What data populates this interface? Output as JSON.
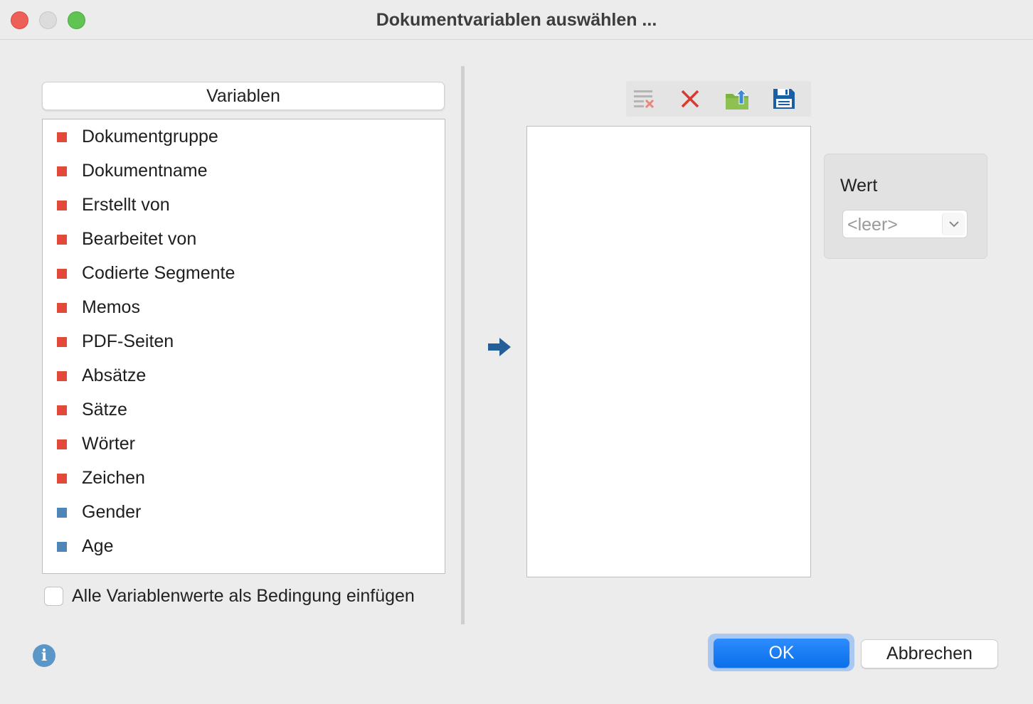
{
  "window": {
    "title": "Dokumentvariablen auswählen ..."
  },
  "variables": {
    "header": "Variablen",
    "items": [
      {
        "label": "Dokumentgruppe",
        "color": "#e2493a"
      },
      {
        "label": "Dokumentname",
        "color": "#e2493a"
      },
      {
        "label": "Erstellt von",
        "color": "#e2493a"
      },
      {
        "label": "Bearbeitet von",
        "color": "#e2493a"
      },
      {
        "label": "Codierte Segmente",
        "color": "#e2493a"
      },
      {
        "label": "Memos",
        "color": "#e2493a"
      },
      {
        "label": "PDF-Seiten",
        "color": "#e2493a"
      },
      {
        "label": "Absätze",
        "color": "#e2493a"
      },
      {
        "label": "Sätze",
        "color": "#e2493a"
      },
      {
        "label": "Wörter",
        "color": "#e2493a"
      },
      {
        "label": "Zeichen",
        "color": "#e2493a"
      },
      {
        "label": "Gender",
        "color": "#4f86b8"
      },
      {
        "label": "Age",
        "color": "#4f86b8"
      }
    ],
    "checkbox_label": "Alle Variablenwerte als Bedingung einfügen",
    "checkbox_checked": false
  },
  "toolbar": {
    "icons": [
      "clear-list-icon",
      "delete-icon",
      "export-folder-icon",
      "save-icon"
    ]
  },
  "wert": {
    "label": "Wert",
    "value": "<leer>"
  },
  "buttons": {
    "ok": "OK",
    "cancel": "Abbrechen"
  },
  "colors": {
    "accent": "#0a6fe9",
    "red_square": "#e2493a",
    "blue_square": "#4f86b8",
    "arrow": "#245f99"
  }
}
